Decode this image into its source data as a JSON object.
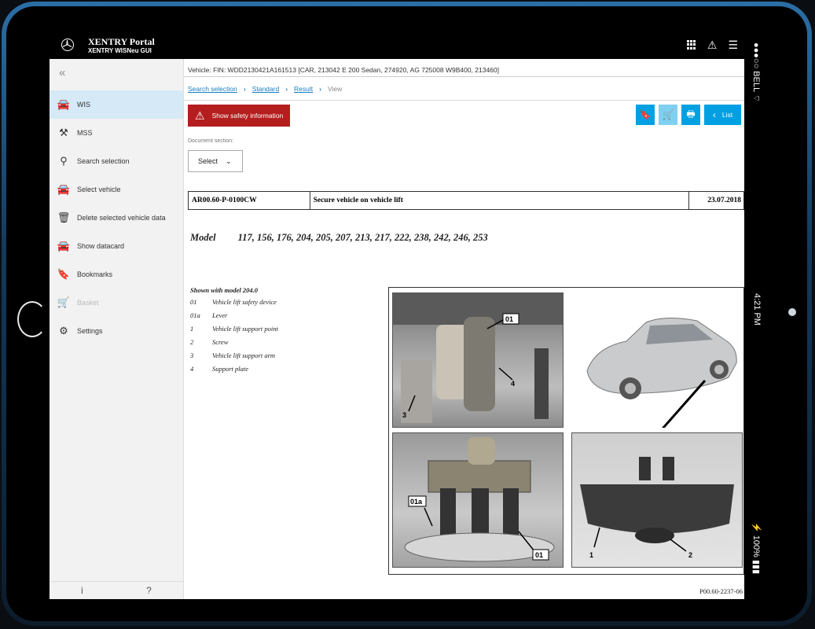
{
  "app": {
    "title": "XENTRY Portal",
    "subtitle": "XENTRY WISNeu GUI"
  },
  "device_status": {
    "carrier": "BELL",
    "time": "4:21 PM",
    "battery": "100%"
  },
  "sidebar": {
    "collapse_glyph": "«",
    "items": [
      {
        "label": "WIS",
        "icon": "car-front-icon",
        "active": true
      },
      {
        "label": "MSS",
        "icon": "tools-icon"
      },
      {
        "label": "Search selection",
        "icon": "search-icon"
      },
      {
        "label": "Select vehicle",
        "icon": "car-front-icon"
      },
      {
        "label": "Delete selected vehicle data",
        "icon": "trash-icon"
      },
      {
        "label": "Show datacard",
        "icon": "car-datacard-icon"
      },
      {
        "label": "Bookmarks",
        "icon": "bookmark-icon"
      },
      {
        "label": "Basket",
        "icon": "basket-icon",
        "disabled": true
      },
      {
        "label": "Settings",
        "icon": "gear-icon"
      }
    ],
    "footer": {
      "info": "i",
      "help": "?"
    }
  },
  "vehicle_line": "Vehicle: FIN: WDD2130421A161513 [CAR, 213042 E 200 Sedan, 274920, AG 725008 W9B400, 213460]",
  "breadcrumb": {
    "items": [
      "Search selection",
      "Standard",
      "Result"
    ],
    "current": "View"
  },
  "safety_button": "Show safety information",
  "toolbar": {
    "list_label": "List"
  },
  "document_section": {
    "label": "Document section:",
    "select_value": "Select"
  },
  "document": {
    "code": "AR00.60-P-0100CW",
    "title": "Secure vehicle on vehicle lift",
    "date": "23.07.2018",
    "model_label": "Model",
    "models": "117, 156, 176, 204, 205, 207, 213, 217, 222, 238, 242, 246, 253"
  },
  "legend": {
    "heading": "Shown with model 204.0",
    "items": [
      {
        "key": "01",
        "text": "Vehicle lift safety device"
      },
      {
        "key": "01a",
        "text": "Lever"
      },
      {
        "key": "1",
        "text": "Vehicle lift support point"
      },
      {
        "key": "2",
        "text": "Screw"
      },
      {
        "key": "3",
        "text": "Vehicle lift support arm"
      },
      {
        "key": "4",
        "text": "Support plate"
      }
    ]
  },
  "figure": {
    "callouts": {
      "a": "01",
      "b": "4",
      "c": "3",
      "d": "01a",
      "e": "01",
      "f": "1",
      "g": "2"
    },
    "code": "P00.60-2237-06"
  },
  "colors": {
    "accent": "#00a0e3",
    "danger": "#b51e1e",
    "link": "#1a7fc1",
    "active_nav": "#d5e9f6"
  }
}
